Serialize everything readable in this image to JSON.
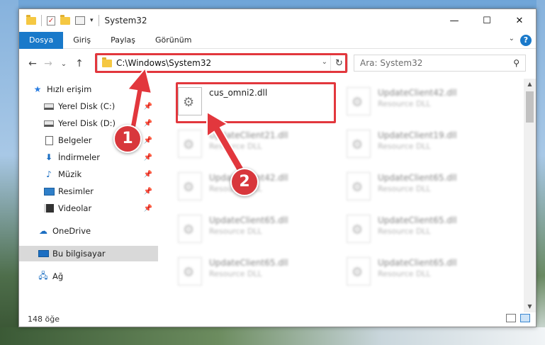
{
  "window": {
    "title": "System32",
    "controls": {
      "minimize": "—",
      "maximize": "☐",
      "close": "✕"
    }
  },
  "ribbon": {
    "tabs": [
      "Dosya",
      "Giriş",
      "Paylaş",
      "Görünüm"
    ],
    "help": "?"
  },
  "navigation": {
    "back": "←",
    "forward": "→",
    "recent": "⌄",
    "up": "↑",
    "address": "C:\\Windows\\System32",
    "search_placeholder": "Ara: System32"
  },
  "sidebar": {
    "items": [
      {
        "label": "Hızlı erişim",
        "icon": "star-icon"
      },
      {
        "label": "Yerel Disk (C:)",
        "icon": "drive-icon",
        "pinned": true
      },
      {
        "label": "Yerel Disk (D:)",
        "icon": "drive-icon",
        "pinned": true
      },
      {
        "label": "Belgeler",
        "icon": "document-icon",
        "pinned": true
      },
      {
        "label": "İndirmeler",
        "icon": "download-icon",
        "pinned": true
      },
      {
        "label": "Müzik",
        "icon": "music-icon",
        "pinned": true
      },
      {
        "label": "Resimler",
        "icon": "picture-icon",
        "pinned": true
      },
      {
        "label": "Videolar",
        "icon": "video-icon",
        "pinned": true
      },
      {
        "label": "OneDrive",
        "icon": "cloud-icon"
      },
      {
        "label": "Bu bilgisayar",
        "icon": "computer-icon",
        "selected": true
      },
      {
        "label": "Ağ",
        "icon": "network-icon"
      }
    ]
  },
  "files": [
    {
      "name": "cus_omni2.dll",
      "type": "",
      "highlighted": true
    },
    {
      "name": "UpdateClient42.dll",
      "type": "Resource DLL"
    },
    {
      "name": "UpdateClient21.dll",
      "type": "Resource DLL"
    },
    {
      "name": "UpdateClient19.dll",
      "type": "Resource DLL"
    },
    {
      "name": "UpdateClient42.dll",
      "type": "Resource DLL"
    },
    {
      "name": "UpdateClient65.dll",
      "type": "Resource DLL"
    },
    {
      "name": "UpdateClient65.dll",
      "type": "Resource DLL"
    },
    {
      "name": "UpdateClient65.dll",
      "type": "Resource DLL"
    },
    {
      "name": "UpdateClient65.dll",
      "type": "Resource DLL"
    },
    {
      "name": "UpdateClient65.dll",
      "type": "Resource DLL"
    }
  ],
  "status": {
    "item_count": "148 öğe"
  },
  "annotations": {
    "step1": "1",
    "step2": "2",
    "highlight_color": "#e2373d"
  },
  "colors": {
    "accent": "#1979ca",
    "selection": "#d9d9d9"
  }
}
